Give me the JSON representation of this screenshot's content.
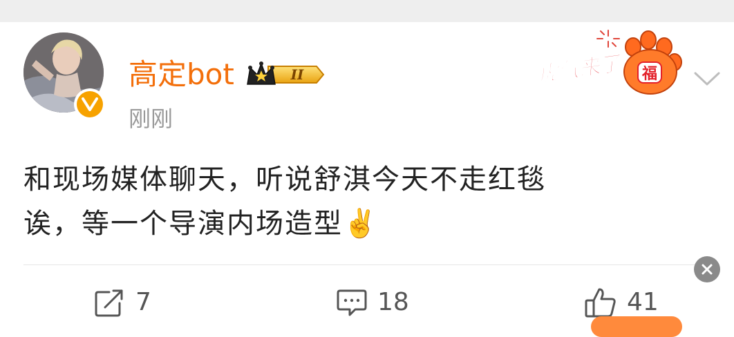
{
  "post": {
    "author": "高定bot",
    "vip_level": "II",
    "timestamp": "刚刚",
    "text_line1": "和现场媒体聊天，听说舒淇今天不走红毯",
    "text_line2": "诶，等一个导演内场造型",
    "emoji": "✌️"
  },
  "decoration": {
    "label": "虎气来了",
    "badge_char": "福"
  },
  "actions": {
    "repost_count": "7",
    "comment_count": "18",
    "like_count": "41"
  },
  "icons": {
    "repost": "share-icon",
    "comment": "comment-icon",
    "like": "thumbs-up-icon",
    "chevron": "chevron-down-icon",
    "close": "close-icon",
    "verified": "verified-v-icon"
  },
  "colors": {
    "username": "#f36f0b",
    "verified": "#f7a200",
    "text": "#222222",
    "muted": "#999999"
  }
}
